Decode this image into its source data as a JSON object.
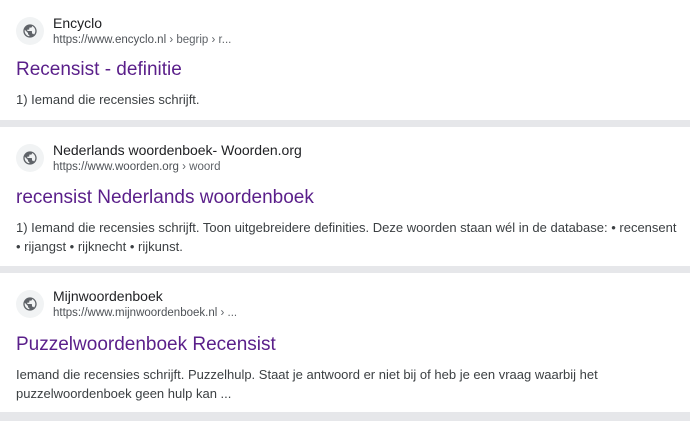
{
  "results": [
    {
      "site_name": "Encyclo",
      "url_base": "https://www.encyclo.nl",
      "url_crumbs": " › begrip › r...",
      "title": "Recensist - definitie",
      "snippet": "1) Iemand die recensies schrijft.",
      "icon": "globe-icon"
    },
    {
      "site_name": "Nederlands woordenboek- Woorden.org",
      "url_base": "https://www.woorden.org",
      "url_crumbs": " › woord",
      "title": "recensist Nederlands woordenboek",
      "snippet": "1) Iemand die recensies schrijft. Toon uitgebreidere definities. Deze woorden staan wél in de database: • recensent • rijangst • rijknecht • rijkunst.",
      "icon": "globe-icon"
    },
    {
      "site_name": "Mijnwoordenboek",
      "url_base": "https://www.mijnwoordenboek.nl",
      "url_crumbs": " › ...",
      "title": "Puzzelwoordenboek Recensist",
      "snippet": "Iemand die recensies schrijft. Puzzelhulp. Staat je antwoord er niet bij of heb je een vraag waarbij het puzzelwoordenboek geen hulp kan ...",
      "icon": "globe-icon"
    }
  ],
  "colors": {
    "title_link": "#5a1f8a",
    "separator": "#e6e7ea",
    "snippet_text": "#3c4043"
  }
}
